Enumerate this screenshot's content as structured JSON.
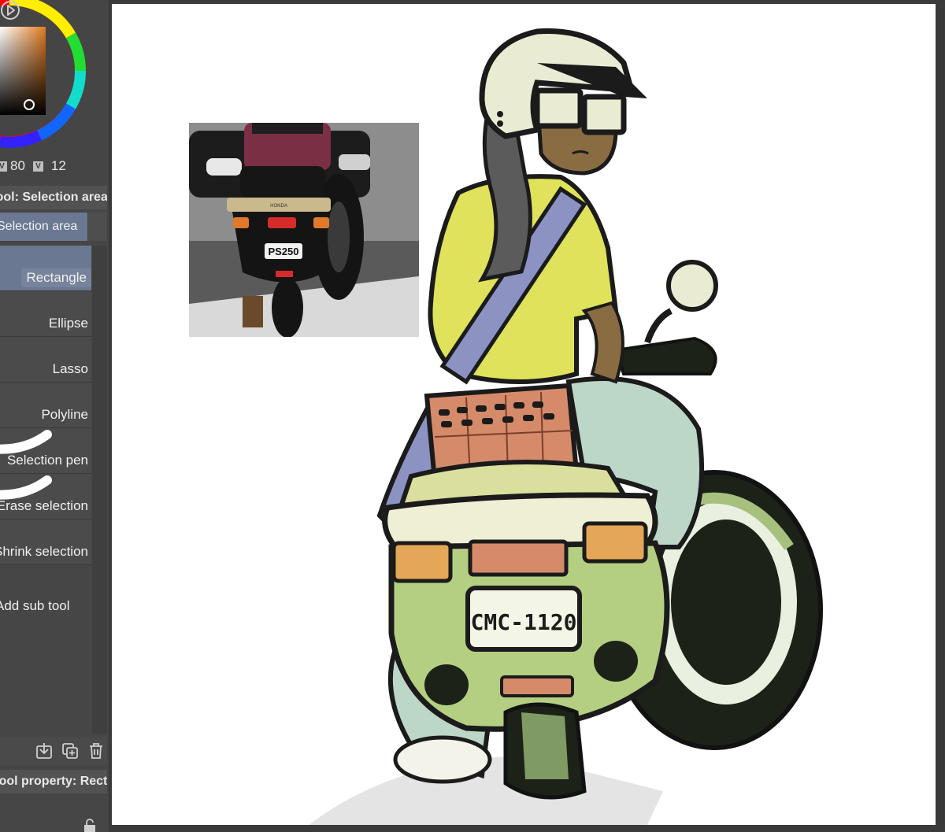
{
  "color": {
    "values": [
      "80",
      "12"
    ],
    "value_labels": [
      "V",
      "V"
    ],
    "current_hex": "#1a1a1a",
    "wheel_square_top": "#e07a1f"
  },
  "tool": {
    "header": "Tool: Selection area",
    "group_tab": "Selection area",
    "subtools": [
      {
        "label": "Rectangle",
        "selected": true
      },
      {
        "label": "Ellipse",
        "selected": false
      },
      {
        "label": "Lasso",
        "selected": false
      },
      {
        "label": "Polyline",
        "selected": false
      },
      {
        "label": "Selection pen",
        "selected": false
      },
      {
        "label": "Erase selection",
        "selected": false
      },
      {
        "label": "Shrink selection",
        "selected": false
      }
    ],
    "add_sub_tool": "Add sub tool",
    "property_header": "Tool property: Rectangle"
  },
  "icons": {
    "play": "play-circle-icon",
    "import": "import-icon",
    "duplicate": "duplicate-icon",
    "delete": "trash-icon",
    "lock": "lock-icon"
  },
  "reference": {
    "plate_text": "PS250",
    "brand_text": "HONDA"
  },
  "illustration": {
    "plate_text": "CMC-1120"
  },
  "accent": "#6b7891"
}
